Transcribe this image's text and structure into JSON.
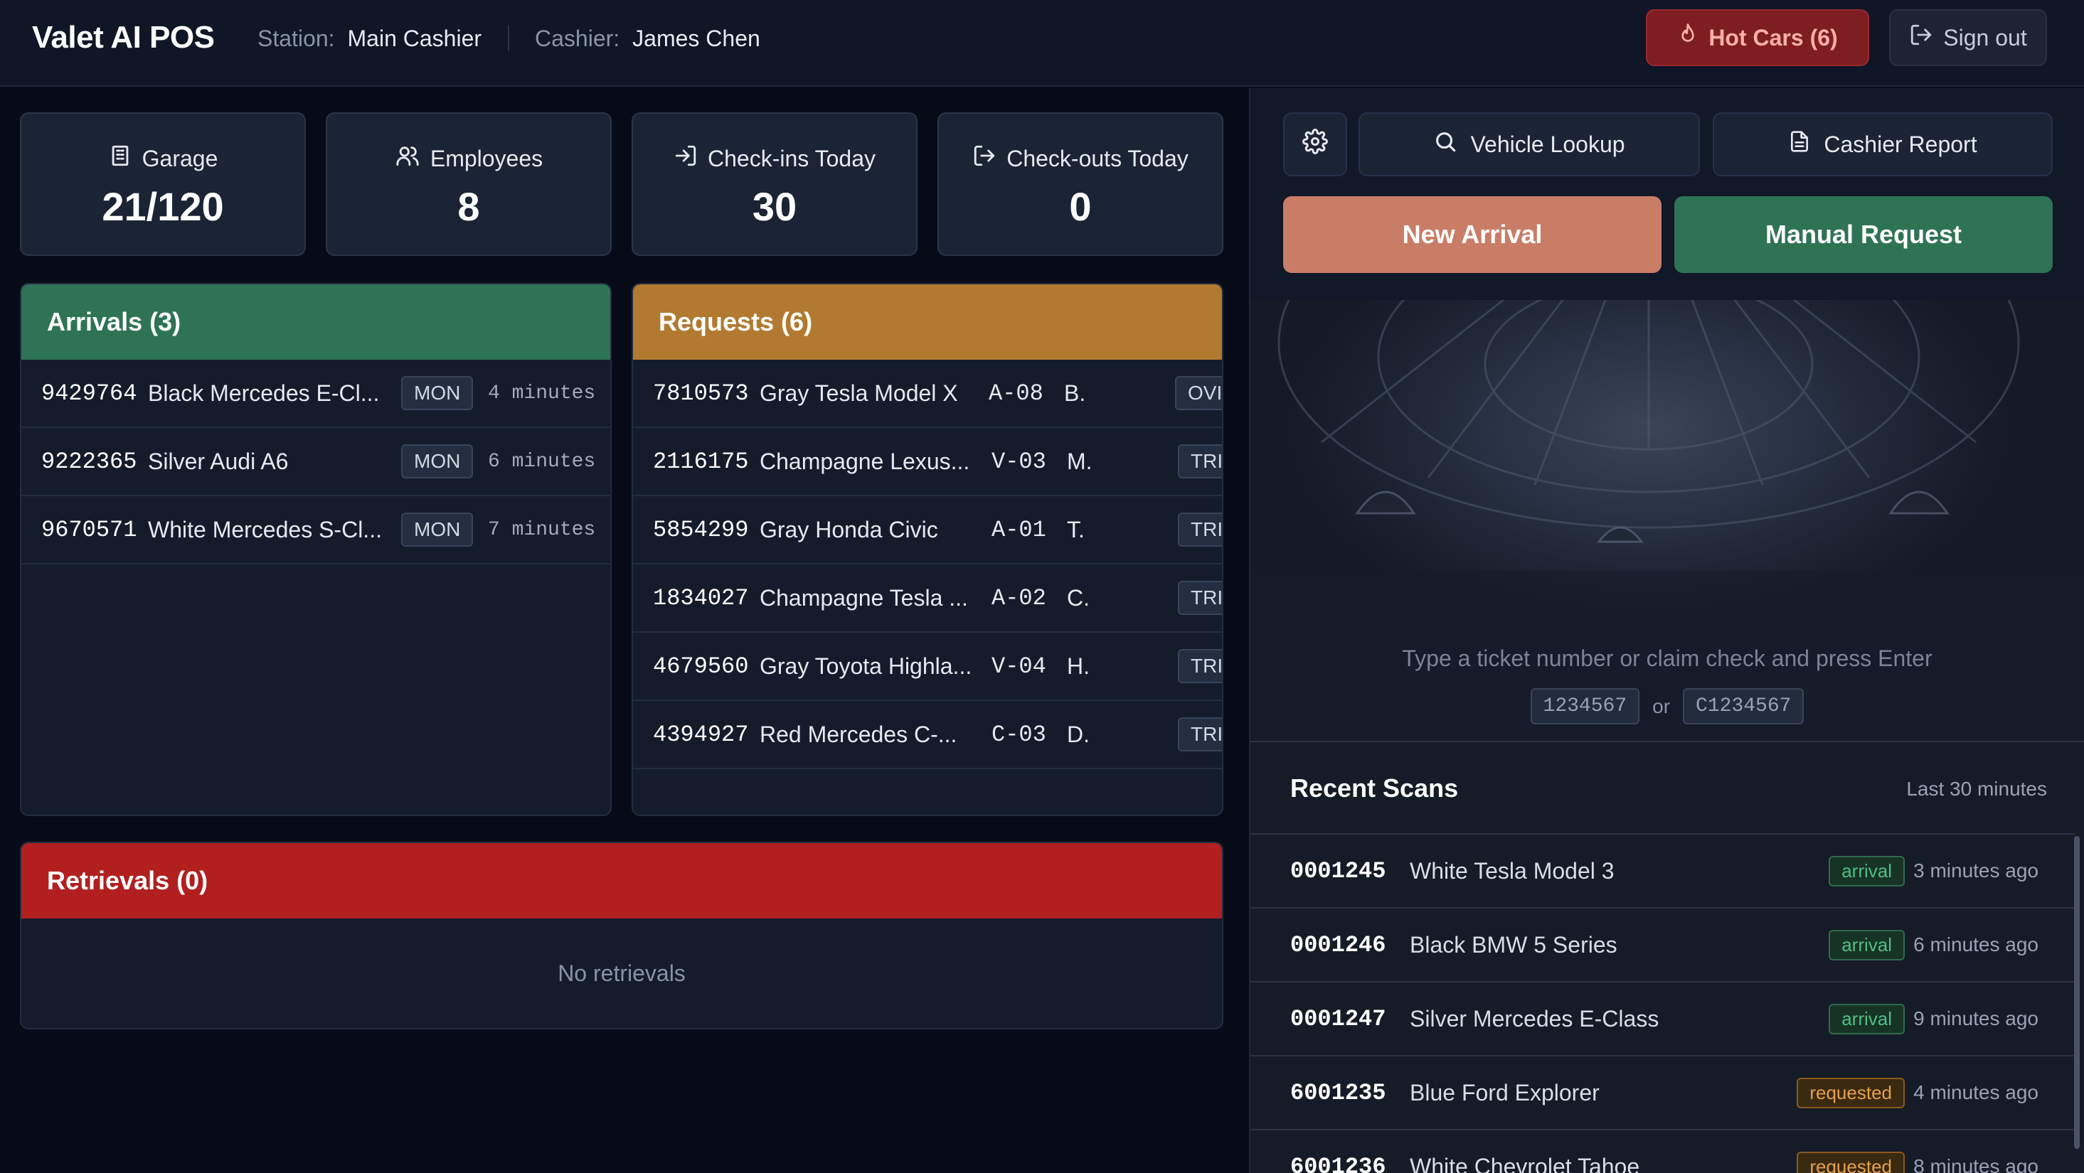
{
  "header": {
    "brand": "Valet AI POS",
    "station_label": "Station:",
    "station_value": "Main Cashier",
    "cashier_label": "Cashier:",
    "cashier_value": "James Chen",
    "hot_cars_label": "Hot Cars (6)",
    "sign_out_label": "Sign out"
  },
  "stats": [
    {
      "label": "Garage",
      "value": "21/120",
      "icon": "building-icon"
    },
    {
      "label": "Employees",
      "value": "8",
      "icon": "users-icon"
    },
    {
      "label": "Check-ins Today",
      "value": "30",
      "icon": "login-icon"
    },
    {
      "label": "Check-outs Today",
      "value": "0",
      "icon": "logout-icon"
    }
  ],
  "arrivals": {
    "title": "Arrivals (3)",
    "rows": [
      {
        "ticket": "9429764",
        "car": "Black Mercedes E-Cl...",
        "tag": "MON",
        "time": "4 minutes"
      },
      {
        "ticket": "9222365",
        "car": "Silver Audi A6",
        "tag": "MON",
        "time": "6 minutes"
      },
      {
        "ticket": "9670571",
        "car": "White Mercedes S-Cl...",
        "tag": "MON",
        "time": "7 minutes"
      }
    ]
  },
  "requests": {
    "title": "Requests (6)",
    "rows": [
      {
        "ticket": "7810573",
        "car": "Gray Tesla Model X",
        "spot": "A-08",
        "initial": "B.",
        "tag": "OVI"
      },
      {
        "ticket": "2116175",
        "car": "Champagne Lexus...",
        "spot": "V-03",
        "initial": "M.",
        "tag": "TRI"
      },
      {
        "ticket": "5854299",
        "car": "Gray Honda Civic",
        "spot": "A-01",
        "initial": "T.",
        "tag": "TRI"
      },
      {
        "ticket": "1834027",
        "car": "Champagne Tesla ...",
        "spot": "A-02",
        "initial": "C.",
        "tag": "TRI"
      },
      {
        "ticket": "4679560",
        "car": "Gray Toyota Highla...",
        "spot": "V-04",
        "initial": "H.",
        "tag": "TRI"
      },
      {
        "ticket": "4394927",
        "car": "Red Mercedes C-...",
        "spot": "C-03",
        "initial": "D.",
        "tag": "TRI"
      }
    ]
  },
  "retrievals": {
    "title": "Retrievals (0)",
    "empty_text": "No retrievals"
  },
  "toolbar": {
    "vehicle_lookup": "Vehicle Lookup",
    "cashier_report": "Cashier Report",
    "new_arrival": "New Arrival",
    "manual_request": "Manual Request"
  },
  "scan": {
    "hint": "Type a ticket number or claim check and press Enter",
    "example1": "1234567",
    "or": "or",
    "example2": "C1234567"
  },
  "recent": {
    "title": "Recent Scans",
    "subtitle": "Last 30 minutes",
    "rows": [
      {
        "ticket": "0001245",
        "car": "White Tesla Model 3",
        "status": "arrival",
        "ago": "3 minutes ago"
      },
      {
        "ticket": "0001246",
        "car": "Black BMW 5 Series",
        "status": "arrival",
        "ago": "6 minutes ago"
      },
      {
        "ticket": "0001247",
        "car": "Silver Mercedes E-Class",
        "status": "arrival",
        "ago": "9 minutes ago"
      },
      {
        "ticket": "6001235",
        "car": "Blue Ford Explorer",
        "status": "requested",
        "ago": "4 minutes ago"
      },
      {
        "ticket": "6001236",
        "car": "White Chevrolet Tahoe",
        "status": "requested",
        "ago": "8 minutes ago"
      }
    ]
  },
  "colors": {
    "arrivals_header": "#2f7355",
    "requests_header": "#b27a30",
    "retrievals_header": "#b21f1f",
    "new_arrival": "#c97d66",
    "manual_request": "#2f7355"
  }
}
